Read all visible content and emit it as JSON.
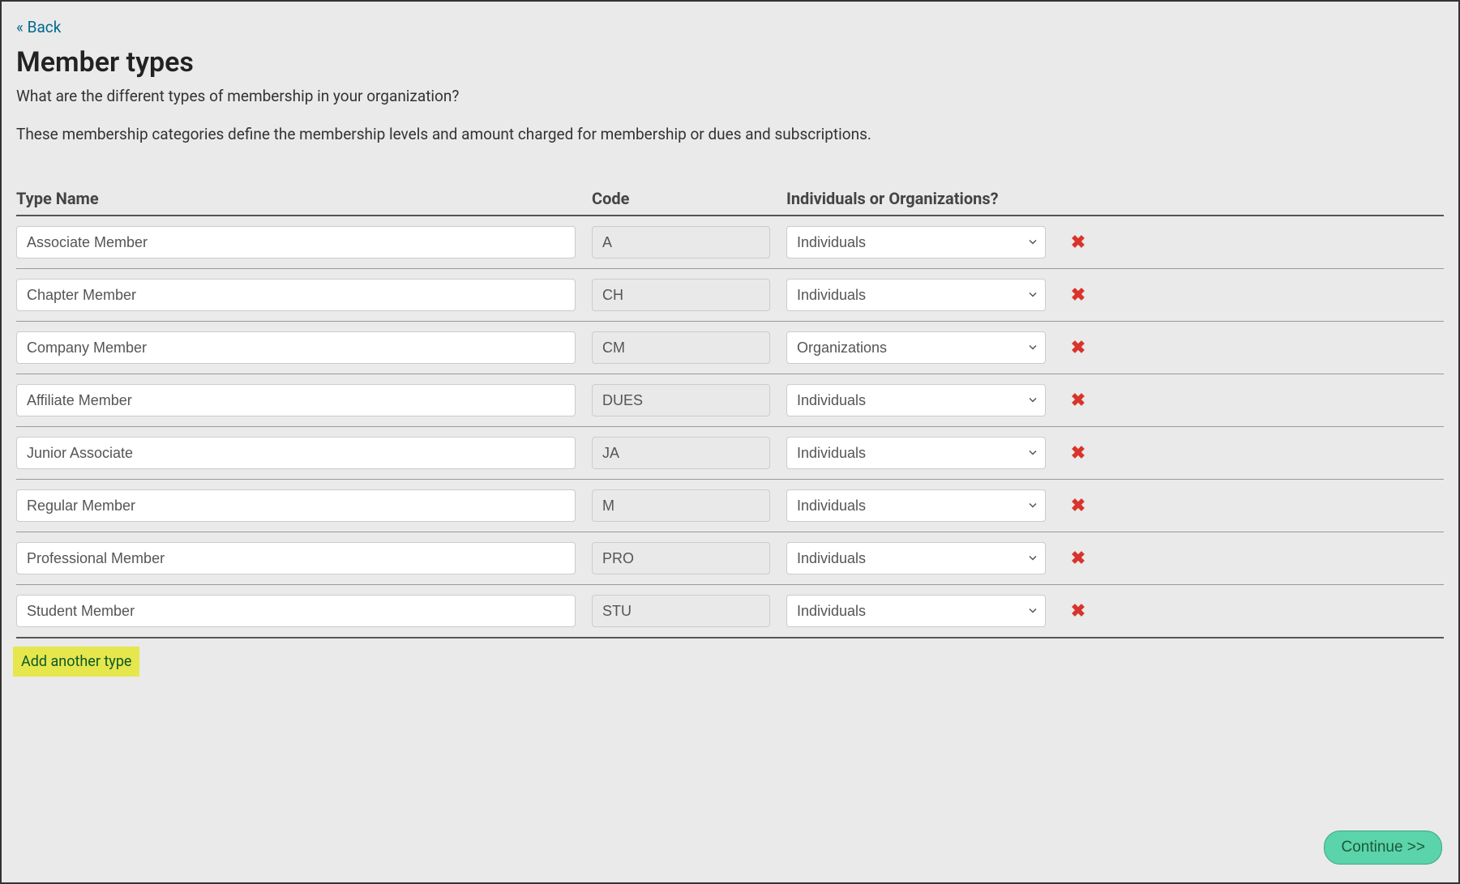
{
  "nav": {
    "back_label": "« Back"
  },
  "header": {
    "title": "Member types",
    "subtitle": "What are the different types of membership in your organization?",
    "description": "These membership categories define the membership levels and amount charged for membership or dues and subscriptions."
  },
  "columns": {
    "name": "Type Name",
    "code": "Code",
    "select": "Individuals or Organizations?"
  },
  "select_options": [
    "Individuals",
    "Organizations"
  ],
  "rows": [
    {
      "name": "Associate Member",
      "code": "A",
      "select": "Individuals"
    },
    {
      "name": "Chapter Member",
      "code": "CH",
      "select": "Individuals"
    },
    {
      "name": "Company Member",
      "code": "CM",
      "select": "Organizations"
    },
    {
      "name": "Affiliate Member",
      "code": "DUES",
      "select": "Individuals"
    },
    {
      "name": "Junior Associate",
      "code": "JA",
      "select": "Individuals"
    },
    {
      "name": "Regular Member",
      "code": "M",
      "select": "Individuals"
    },
    {
      "name": "Professional Member",
      "code": "PRO",
      "select": "Individuals"
    },
    {
      "name": "Student Member",
      "code": "STU",
      "select": "Individuals"
    }
  ],
  "actions": {
    "add_type": "Add another type",
    "continue": "Continue >>"
  }
}
